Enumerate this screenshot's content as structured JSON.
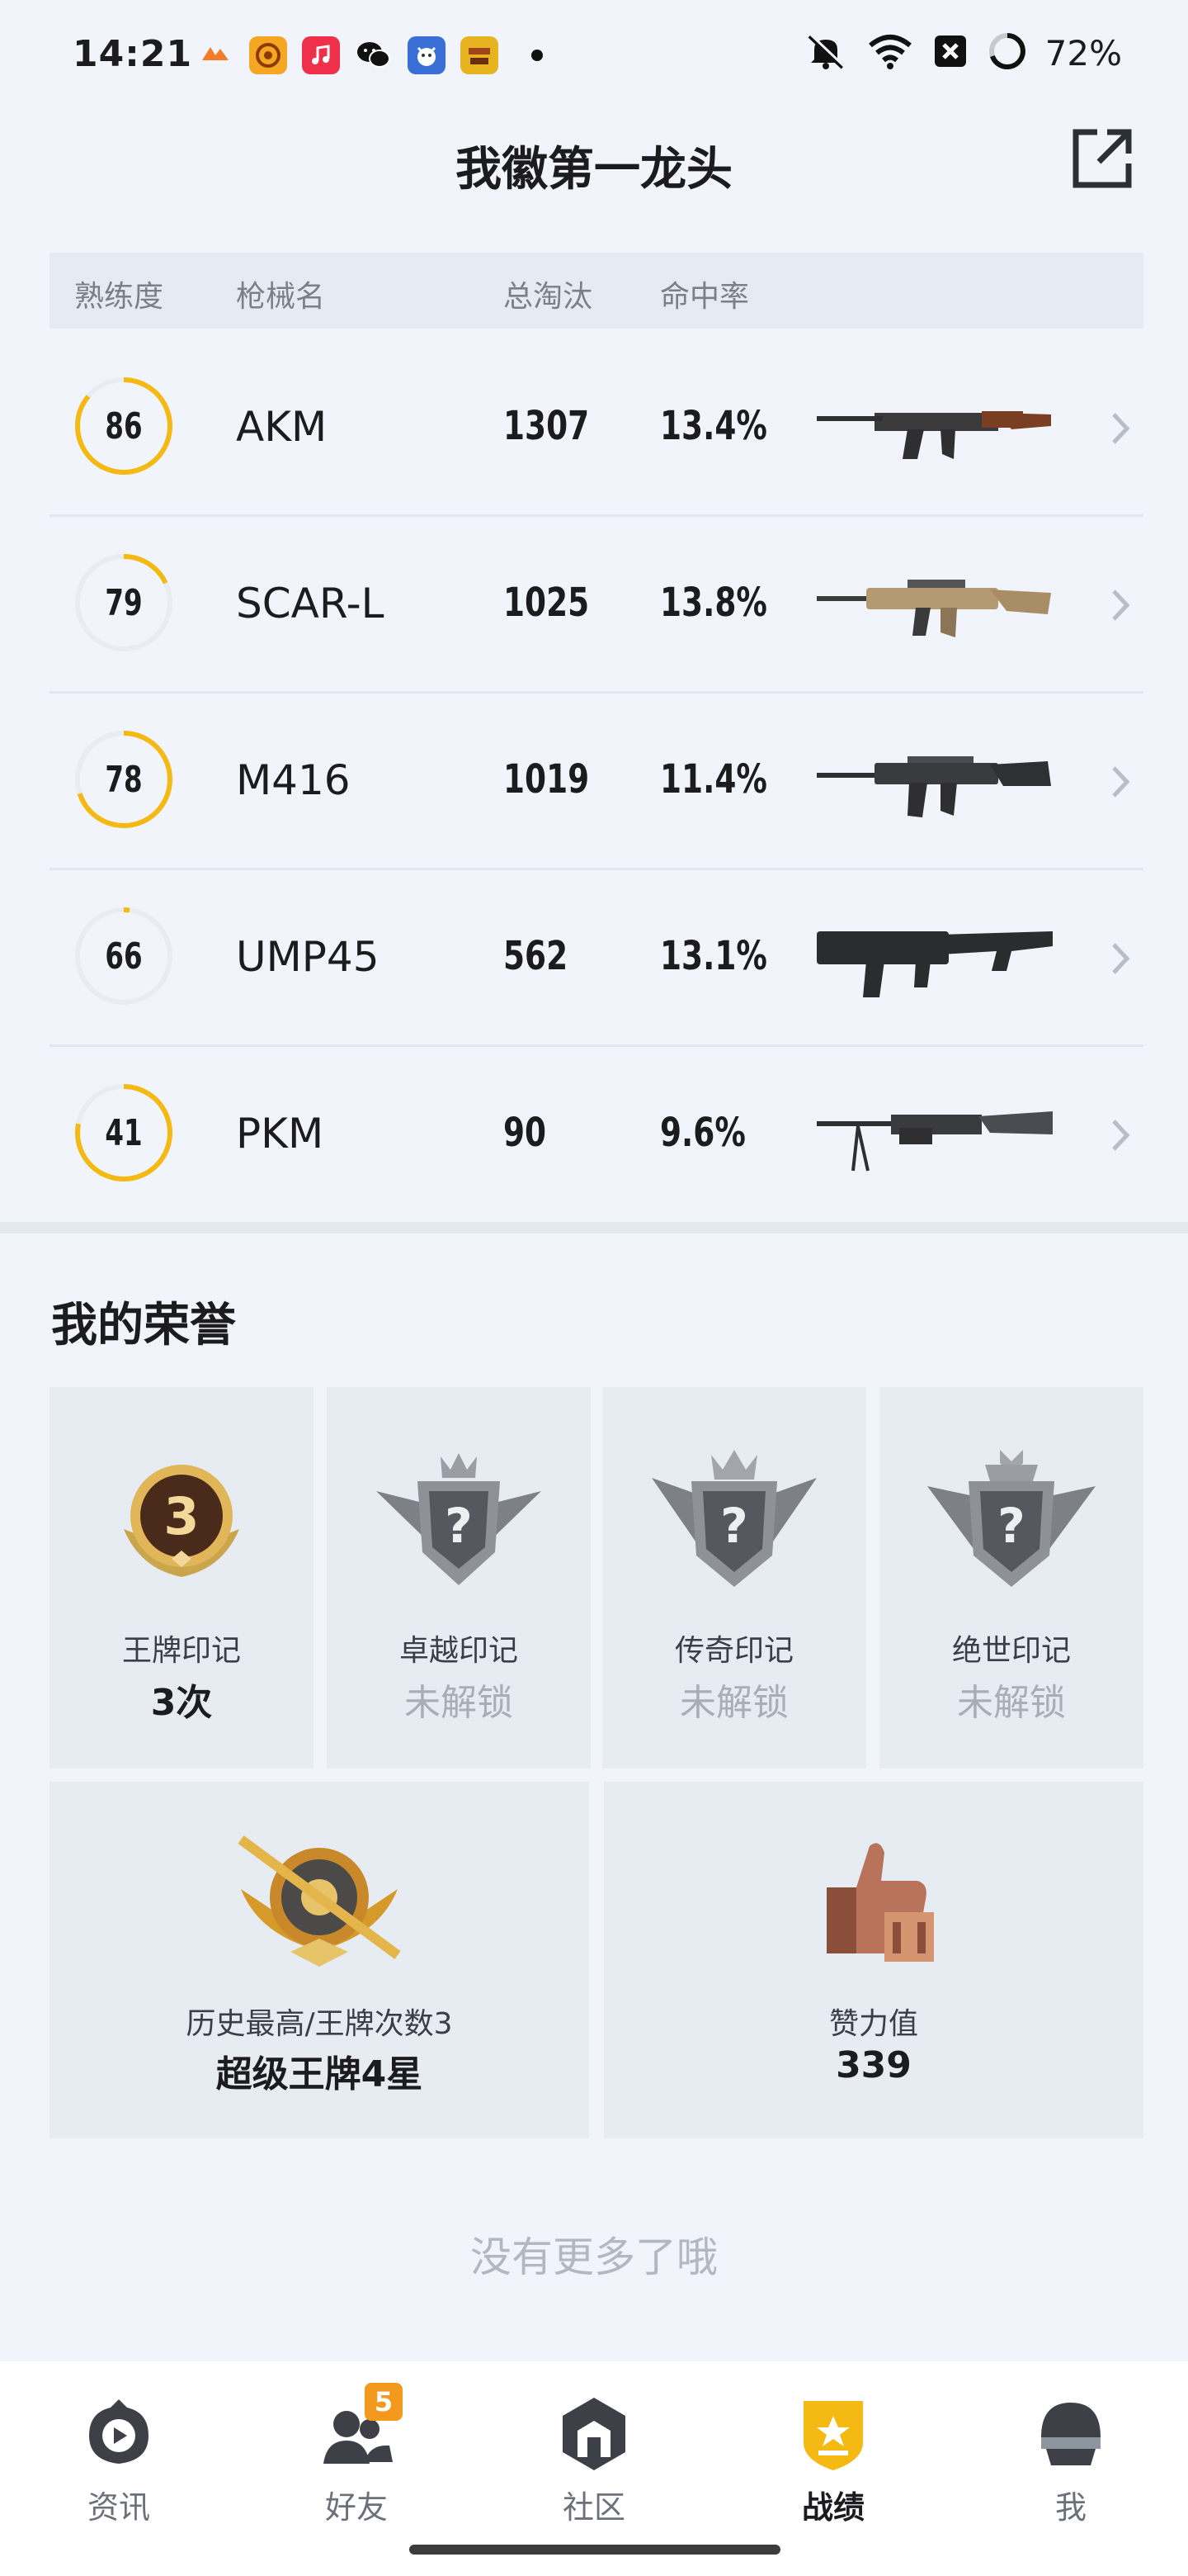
{
  "status_bar": {
    "time": "14:21",
    "battery": "72%",
    "notification_icons": [
      "app-icon-orange",
      "app-icon-coin",
      "music-icon",
      "wechat-icon",
      "game-icon-blue",
      "game-icon-yellow"
    ]
  },
  "header": {
    "title": "我徽第一龙头",
    "share_icon": "share-icon"
  },
  "table": {
    "columns": [
      "熟练度",
      "枪械名",
      "总淘汰",
      "命中率"
    ],
    "rows": [
      {
        "proficiency": "86",
        "progress": 0.86,
        "weapon": "AKM",
        "kills": "1307",
        "hit_rate": "13.4%"
      },
      {
        "proficiency": "79",
        "progress": 0.18,
        "weapon": "SCAR-L",
        "kills": "1025",
        "hit_rate": "13.8%"
      },
      {
        "proficiency": "78",
        "progress": 0.7,
        "weapon": "M416",
        "kills": "1019",
        "hit_rate": "11.4%"
      },
      {
        "proficiency": "66",
        "progress": 0.02,
        "weapon": "UMP45",
        "kills": "562",
        "hit_rate": "13.1%"
      },
      {
        "proficiency": "41",
        "progress": 0.78,
        "weapon": "PKM",
        "kills": "90",
        "hit_rate": "9.6%"
      }
    ]
  },
  "honor": {
    "title": "我的荣誉",
    "marks": [
      {
        "name": "王牌印记",
        "value": "3次",
        "badge_number": "3",
        "locked": false
      },
      {
        "name": "卓越印记",
        "value": "未解锁",
        "badge_number": "?",
        "locked": true
      },
      {
        "name": "传奇印记",
        "value": "未解锁",
        "badge_number": "?",
        "locked": true
      },
      {
        "name": "绝世印记",
        "value": "未解锁",
        "badge_number": "?",
        "locked": true
      }
    ],
    "highest": {
      "label": "历史最高/王牌次数3",
      "value": "超级王牌4星"
    },
    "likes": {
      "label": "赞力值",
      "value": "339"
    }
  },
  "footer_text": "没有更多了哦",
  "nav": {
    "items": [
      {
        "label": "资讯",
        "icon": "news-icon",
        "active": false
      },
      {
        "label": "好友",
        "icon": "friends-icon",
        "active": false,
        "badge": "5"
      },
      {
        "label": "社区",
        "icon": "community-icon",
        "active": false
      },
      {
        "label": "战绩",
        "icon": "record-icon",
        "active": true
      },
      {
        "label": "我",
        "icon": "profile-icon",
        "active": false
      }
    ]
  },
  "colors": {
    "accent": "#f5b914",
    "ring_track": "#e9edf2",
    "background": "#f1f5fb"
  }
}
